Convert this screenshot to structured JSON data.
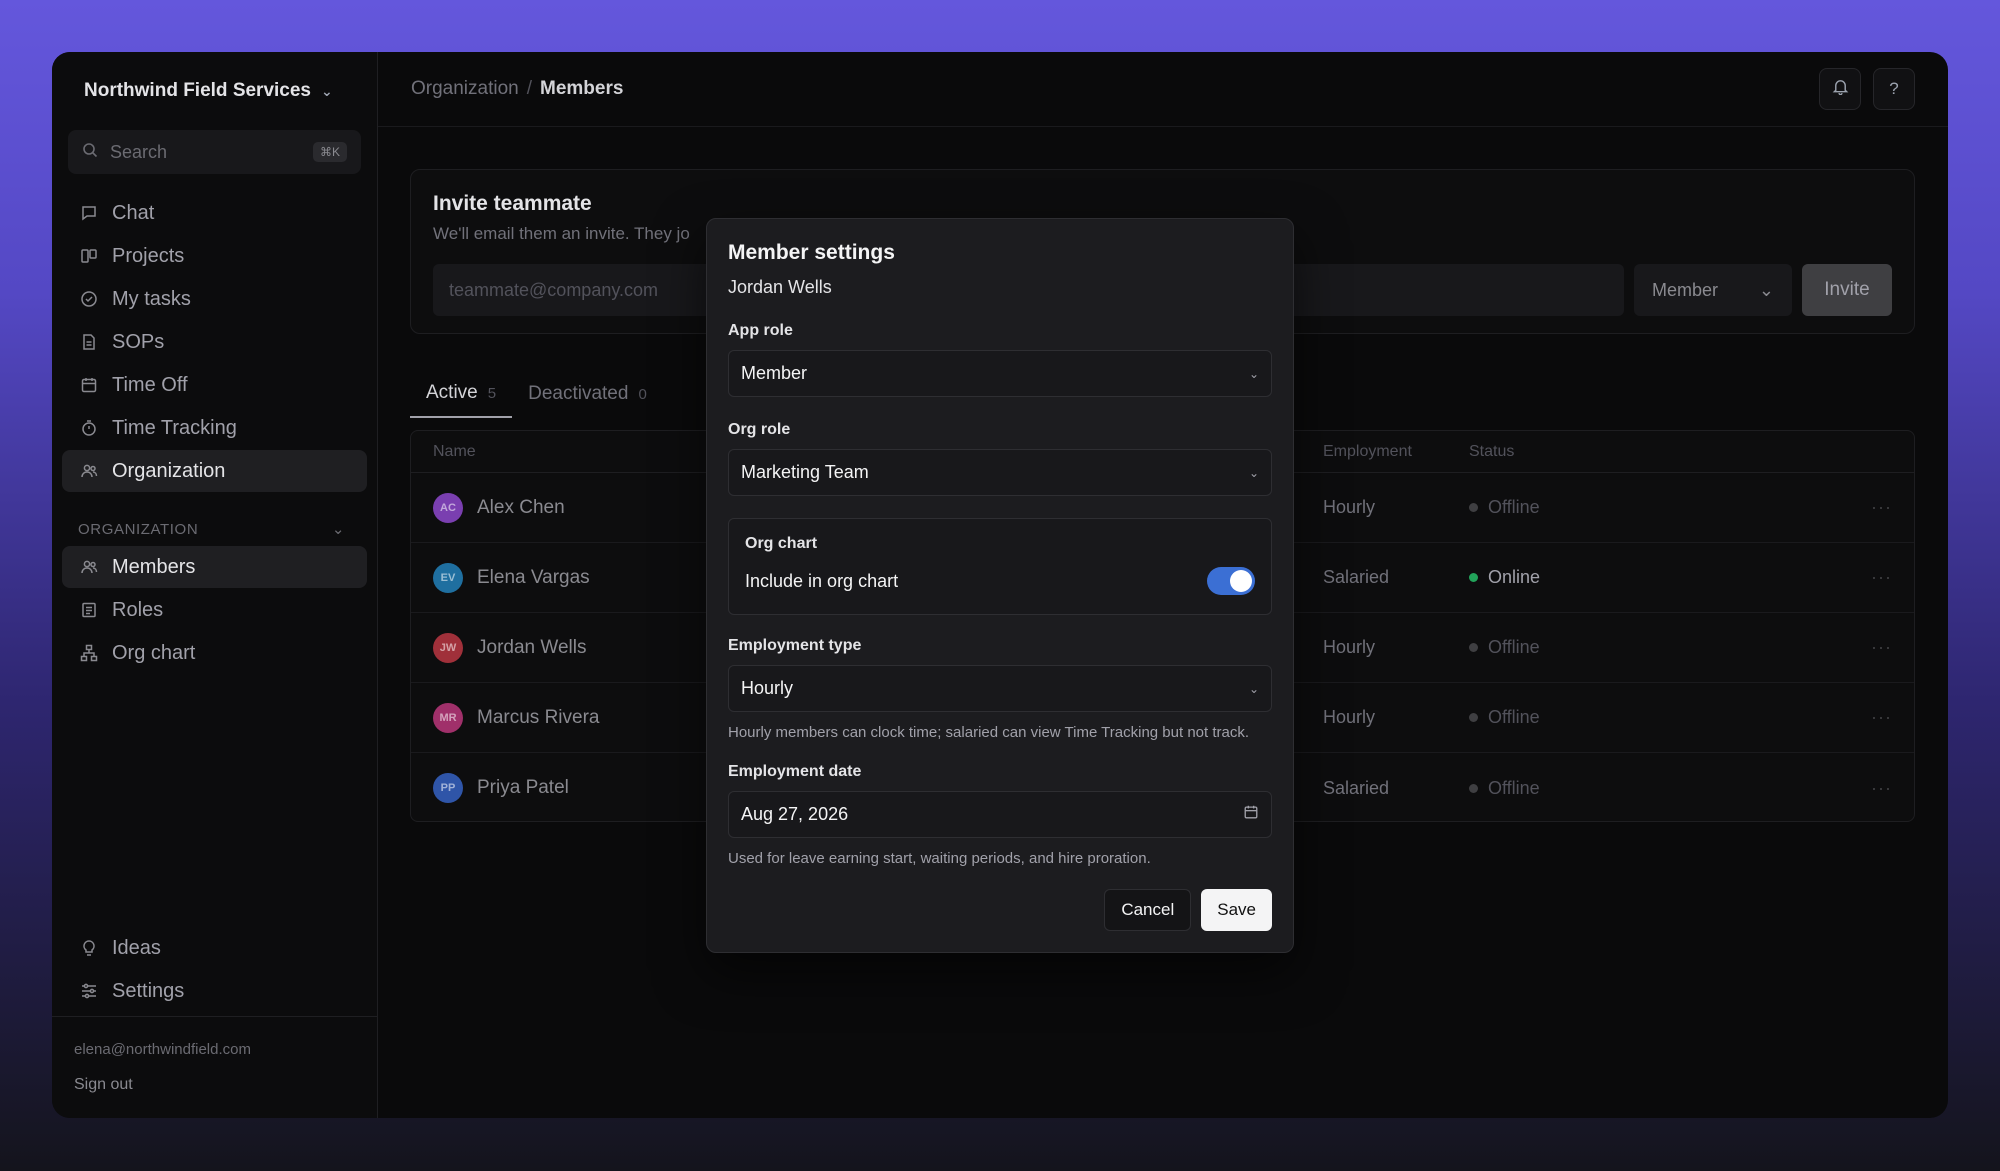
{
  "workspace": {
    "name": "Northwind Field Services"
  },
  "search": {
    "placeholder": "Search",
    "shortcut": "⌘K"
  },
  "nav": {
    "items": [
      {
        "label": "Chat",
        "icon": "chat-icon"
      },
      {
        "label": "Projects",
        "icon": "board-icon"
      },
      {
        "label": "My tasks",
        "icon": "check-circle-icon"
      },
      {
        "label": "SOPs",
        "icon": "document-icon"
      },
      {
        "label": "Time Off",
        "icon": "calendar-icon"
      },
      {
        "label": "Time Tracking",
        "icon": "stopwatch-icon"
      },
      {
        "label": "Organization",
        "icon": "users-icon",
        "active": true
      }
    ],
    "section_label": "ORGANIZATION",
    "section_items": [
      {
        "label": "Members",
        "icon": "users-icon",
        "active": true
      },
      {
        "label": "Roles",
        "icon": "list-icon"
      },
      {
        "label": "Org chart",
        "icon": "org-chart-icon"
      }
    ],
    "bottom_items": [
      {
        "label": "Ideas",
        "icon": "lightbulb-icon"
      },
      {
        "label": "Settings",
        "icon": "sliders-icon"
      }
    ]
  },
  "account": {
    "email": "elena@northwindfield.com",
    "signout": "Sign out"
  },
  "breadcrumb": {
    "parent": "Organization",
    "separator": "/",
    "current": "Members"
  },
  "topbar": {
    "help_label": "?"
  },
  "invite": {
    "title": "Invite teammate",
    "subtitle": "We'll email them an invite. They jo",
    "email_placeholder": "teammate@company.com",
    "role_value": "Member",
    "button": "Invite"
  },
  "tabs": [
    {
      "label": "Active",
      "count": "5",
      "active": true
    },
    {
      "label": "Deactivated",
      "count": "0"
    }
  ],
  "table": {
    "headers": {
      "name": "Name",
      "employment": "Employment",
      "status": "Status"
    },
    "rows": [
      {
        "initials": "AC",
        "name": "Alex Chen",
        "employment": "Hourly",
        "status": "Offline",
        "avatar_color": "#7a3fb0"
      },
      {
        "initials": "EV",
        "name": "Elena Vargas",
        "employment": "Salaried",
        "status": "Online",
        "avatar_color": "#1f6fa0"
      },
      {
        "initials": "JW",
        "name": "Jordan Wells",
        "employment": "Hourly",
        "status": "Offline",
        "avatar_color": "#a0303a"
      },
      {
        "initials": "MR",
        "name": "Marcus Rivera",
        "employment": "Hourly",
        "status": "Offline",
        "avatar_color": "#a0306a"
      },
      {
        "initials": "PP",
        "name": "Priya Patel",
        "employment": "Salaried",
        "status": "Offline",
        "avatar_color": "#2f55a8"
      }
    ],
    "more_label": "···"
  },
  "modal": {
    "title": "Member settings",
    "member_name": "Jordan Wells",
    "app_role_label": "App role",
    "app_role_value": "Member",
    "org_role_label": "Org role",
    "org_role_value": "Marketing Team",
    "org_chart_title": "Org chart",
    "org_chart_toggle_label": "Include in org chart",
    "org_chart_toggle_on": true,
    "employment_type_label": "Employment type",
    "employment_type_value": "Hourly",
    "employment_type_hint": "Hourly members can clock time; salaried can view Time Tracking but not track.",
    "employment_date_label": "Employment date",
    "employment_date_value": "Aug 27, 2026",
    "employment_date_hint": "Used for leave earning start, waiting periods, and hire proration.",
    "cancel": "Cancel",
    "save": "Save"
  },
  "colors": {
    "accent": "#3b6fd4",
    "online": "#22a35a",
    "backdrop_top": "#6457dc"
  }
}
